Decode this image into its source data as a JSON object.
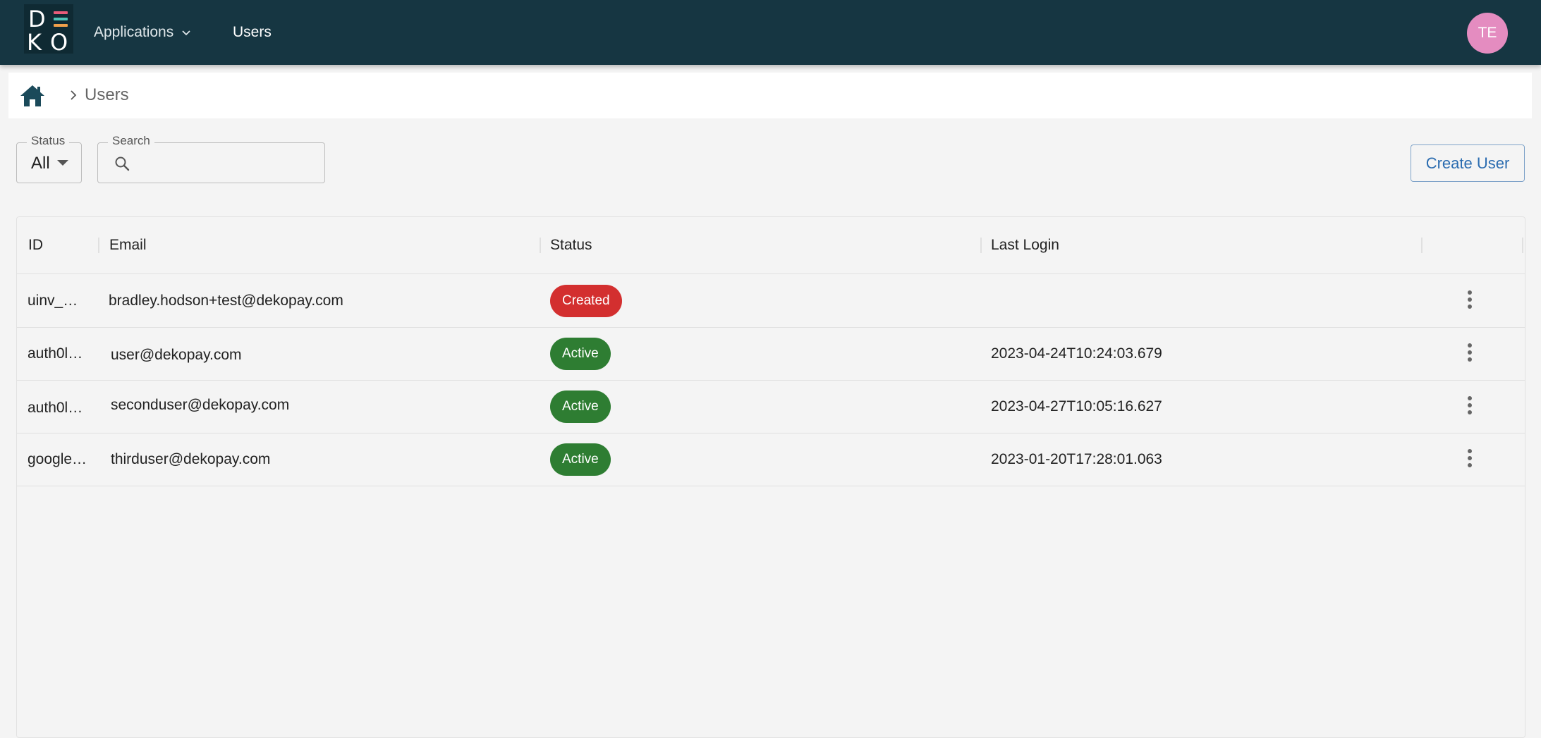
{
  "nav": {
    "logo": {
      "letters": [
        "D",
        "K",
        "O"
      ],
      "bar_colors": [
        "#e85c79",
        "#4fc3b7",
        "#f0a04b"
      ]
    },
    "applications_label": "Applications",
    "users_label": "Users",
    "avatar_initials": "TE"
  },
  "breadcrumb": {
    "current": "Users"
  },
  "filters": {
    "status_label": "Status",
    "status_value": "All",
    "search_label": "Search",
    "search_value": "",
    "create_button": "Create User"
  },
  "table": {
    "columns": [
      "ID",
      "Email",
      "Status",
      "Last Login"
    ],
    "rows": [
      {
        "id": "uinv_…",
        "email": "bradley.hodson+test@dekopay.com",
        "status": "Created",
        "status_color": "#d32f2f",
        "last_login": ""
      },
      {
        "id": "auth0l…",
        "email": "user@dekopay.com",
        "status": "Active",
        "status_color": "#2e7d32",
        "last_login": "2023-04-24T10:24:03.679"
      },
      {
        "id": "auth0l…",
        "email": "seconduser@dekopay.com",
        "status": "Active",
        "status_color": "#2e7d32",
        "last_login": "2023-04-27T10:05:16.627"
      },
      {
        "id": "google…",
        "email": "thirduser@dekopay.com",
        "status": "Active",
        "status_color": "#2e7d32",
        "last_login": "2023-01-20T17:28:01.063"
      }
    ]
  }
}
